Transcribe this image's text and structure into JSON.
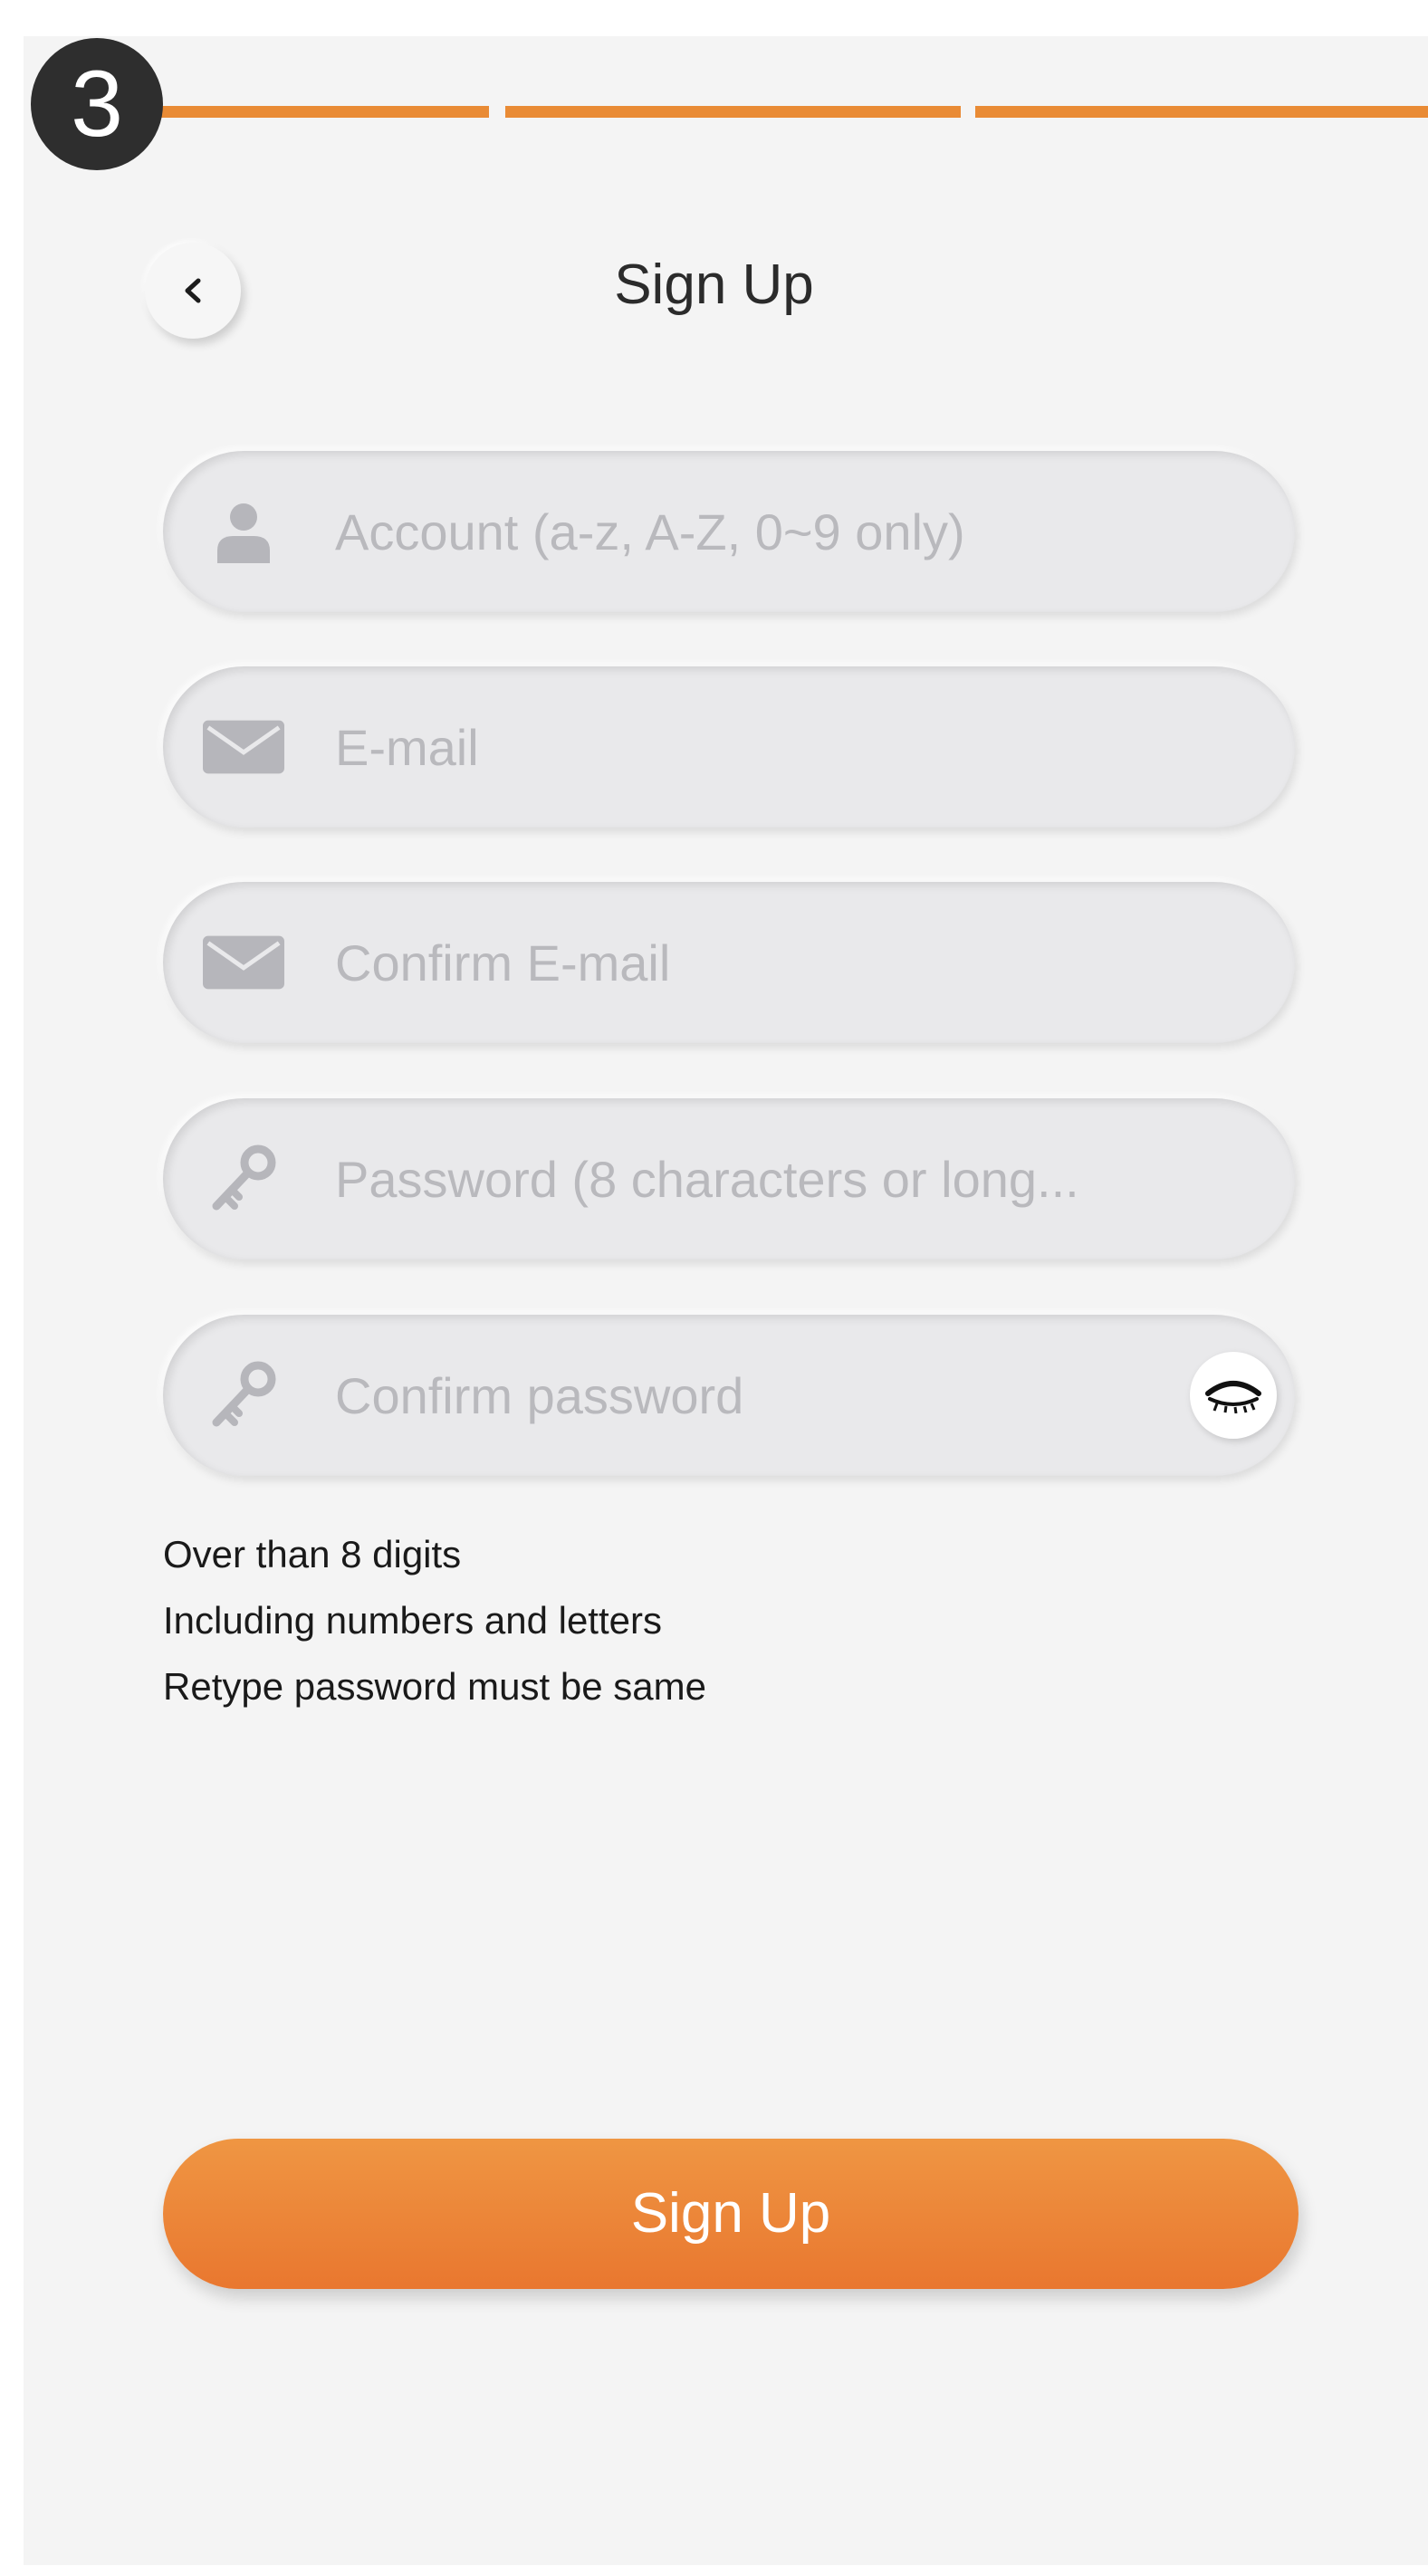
{
  "step": {
    "number": "3",
    "segments": 3,
    "color": "#e98b35"
  },
  "header": {
    "back_icon": "chevron-left-icon",
    "title": "Sign Up"
  },
  "form": {
    "account": {
      "placeholder": "Account (a-z, A-Z, 0~9 only)",
      "icon": "user-icon"
    },
    "email": {
      "placeholder": "E-mail",
      "icon": "envelope-icon"
    },
    "confirm_email": {
      "placeholder": "Confirm E-mail",
      "icon": "envelope-icon"
    },
    "password": {
      "placeholder": "Password (8 characters or long...",
      "icon": "key-icon"
    },
    "confirm_password": {
      "placeholder": "Confirm password",
      "icon": "key-icon",
      "toggle_icon": "eye-closed-icon"
    }
  },
  "hints": [
    "Over than 8 digits",
    "Including numbers and letters",
    "Retype password must be same"
  ],
  "submit": {
    "label": "Sign Up",
    "color": "#e98b35"
  }
}
